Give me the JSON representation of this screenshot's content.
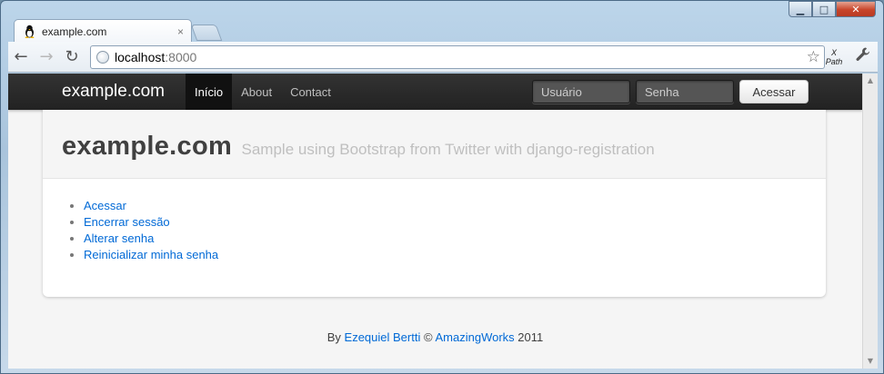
{
  "window": {
    "minimize_glyph": "▁",
    "maximize_glyph": "□",
    "close_glyph": "✕"
  },
  "tab": {
    "title": "example.com",
    "favicon": "linux-penguin-icon",
    "close_glyph": "×"
  },
  "toolbar": {
    "back_glyph": "←",
    "forward_glyph": "→",
    "reload_glyph": "↻",
    "url_host": "localhost",
    "url_port": ":8000",
    "star_glyph": "☆",
    "xpath_top": "X",
    "xpath_bottom": "Path",
    "wrench_glyph": "🔧"
  },
  "navbar": {
    "brand": "example.com",
    "links": [
      {
        "label": "Início",
        "active": true
      },
      {
        "label": "About",
        "active": false
      },
      {
        "label": "Contact",
        "active": false
      }
    ],
    "username_placeholder": "Usuário",
    "password_placeholder": "Senha",
    "submit_label": "Acessar"
  },
  "header": {
    "title": "example.com",
    "subtitle": "Sample using Bootstrap from Twitter with django-registration"
  },
  "links": [
    "Acessar",
    "Encerrar sessão",
    "Alterar senha",
    "Reinicializar minha senha"
  ],
  "footer": {
    "prefix": "By",
    "author": "Ezequiel Bertti",
    "copyright": "©",
    "company": "AmazingWorks",
    "year": "2011"
  },
  "colors": {
    "link": "#0069d6",
    "navbar_bg": "#222222",
    "page_bg": "#f5f5f5"
  }
}
